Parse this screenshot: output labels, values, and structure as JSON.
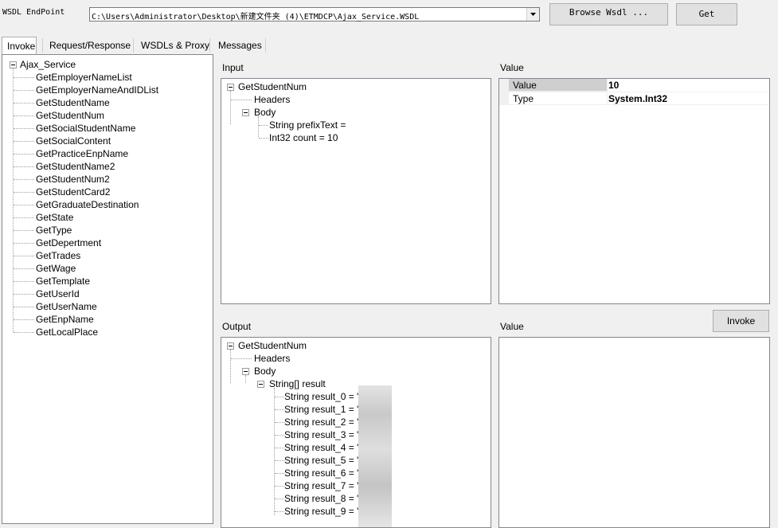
{
  "toolbar": {
    "endpoint_label": "WSDL EndPoint",
    "endpoint_value": "C:\\Users\\Administrator\\Desktop\\新建文件夹 (4)\\ETMDCP\\Ajax_Service.WSDL",
    "browse_label": "Browse Wsdl ...",
    "get_label": "Get"
  },
  "tabs": [
    "Invoke",
    "Request/Response",
    "WSDLs & Proxy",
    "Messages"
  ],
  "service_tree": {
    "root": "Ajax_Service",
    "methods": [
      "GetEmployerNameList",
      "GetEmployerNameAndIDList",
      "GetStudentName",
      "GetStudentNum",
      "GetSocialStudentName",
      "GetSocialContent",
      "GetPracticeEnpName",
      "GetStudentName2",
      "GetStudentNum2",
      "GetStudentCard2",
      "GetGraduateDestination",
      "GetState",
      "GetType",
      "GetDepertment",
      "GetTrades",
      "GetWage",
      "GetTemplate",
      "GetUserId",
      "GetUserName",
      "GetEnpName",
      "GetLocalPlace"
    ],
    "selected_index": 3
  },
  "input": {
    "label": "Input",
    "method": "GetStudentNum",
    "headers": "Headers",
    "body": "Body",
    "params": [
      "String prefixText =",
      "Int32 count = 10"
    ]
  },
  "input_value": {
    "label": "Value",
    "rows": [
      {
        "name": "Value",
        "value": "10"
      },
      {
        "name": "Type",
        "value": "System.Int32"
      }
    ]
  },
  "invoke_label": "Invoke",
  "output": {
    "label": "Output",
    "method": "GetStudentNum",
    "headers": "Headers",
    "body": "Body",
    "array": "String[] result",
    "results": [
      "String result_0 = '20",
      "String result_1 = '20",
      "String result_2 = '20",
      "String result_3 = '20",
      "String result_4 = '20",
      "String result_5 = '20",
      "String result_6 = '20",
      "String result_7 = '20",
      "String result_8 = '20",
      "String result_9 = '20"
    ]
  },
  "output_value": {
    "label": "Value"
  }
}
